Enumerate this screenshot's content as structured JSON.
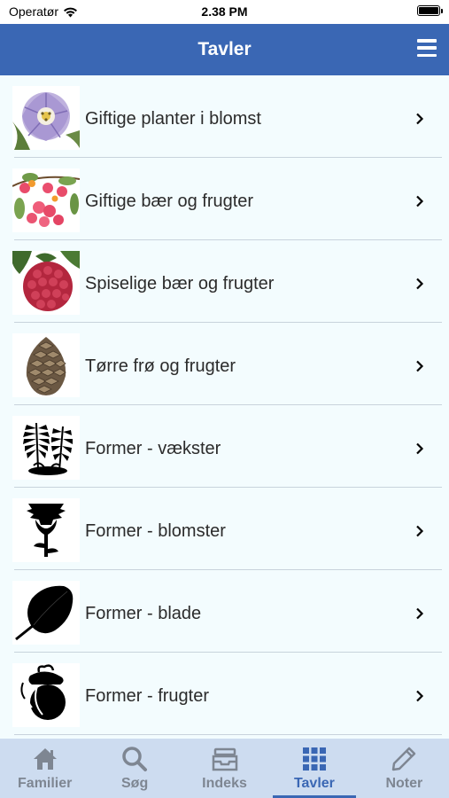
{
  "status_bar": {
    "carrier": "Operatør",
    "time": "2.38 PM"
  },
  "nav": {
    "title": "Tavler"
  },
  "list": {
    "items": [
      {
        "label": "Giftige planter i blomst",
        "icon": "purple-flower-icon"
      },
      {
        "label": "Giftige bær og frugter",
        "icon": "red-berries-icon"
      },
      {
        "label": "Spiselige bær og frugter",
        "icon": "raspberry-icon"
      },
      {
        "label": "Tørre frø og frugter",
        "icon": "pine-cone-icon"
      },
      {
        "label": "Former - vækster",
        "icon": "fern-silhouette-icon"
      },
      {
        "label": "Former - blomster",
        "icon": "flower-silhouette-icon"
      },
      {
        "label": "Former - blade",
        "icon": "leaf-silhouette-icon"
      },
      {
        "label": "Former - frugter",
        "icon": "fruit-silhouette-icon"
      }
    ]
  },
  "tab_bar": {
    "tabs": [
      {
        "label": "Familier",
        "icon": "home-icon"
      },
      {
        "label": "Søg",
        "icon": "search-icon"
      },
      {
        "label": "Indeks",
        "icon": "archive-box-icon"
      },
      {
        "label": "Tavler",
        "icon": "grid-icon",
        "active": true
      },
      {
        "label": "Noter",
        "icon": "pencil-icon"
      }
    ]
  },
  "colors": {
    "nav_blue": "#3a67b4",
    "list_bg": "#f3fcfe",
    "tab_bar_bg": "#cddcf0",
    "tab_inactive": "#7e8692"
  }
}
